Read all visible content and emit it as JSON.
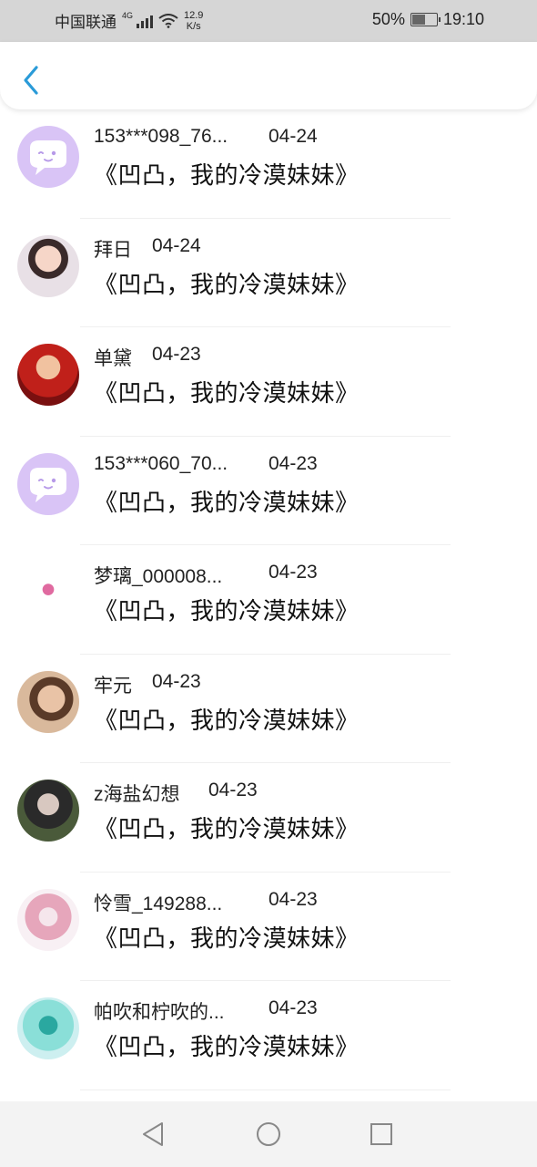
{
  "status_bar": {
    "carrier": "中国联通",
    "network": "4G",
    "speed_value": "12.9",
    "speed_unit": "K/s",
    "battery": "50%",
    "battery_level": 0.5,
    "time": "19:10"
  },
  "header": {
    "back_icon": "chevron-left-icon",
    "accent_color": "#2a9bd8"
  },
  "items": [
    {
      "name": "153***098_76...",
      "date": "04-24",
      "title": "《凹凸，我的冷漠妹妹》",
      "avatar": "default-chat-avatar"
    },
    {
      "name": "拜日",
      "date": "04-24",
      "title": "《凹凸，我的冷漠妹妹》",
      "avatar": "user-photo"
    },
    {
      "name": "单黛",
      "date": "04-23",
      "title": "《凹凸，我的冷漠妹妹》",
      "avatar": "user-photo"
    },
    {
      "name": "153***060_70...",
      "date": "04-23",
      "title": "《凹凸，我的冷漠妹妹》",
      "avatar": "default-chat-avatar"
    },
    {
      "name": "梦璃_000008...",
      "date": "04-23",
      "title": "《凹凸，我的冷漠妹妹》",
      "avatar": "user-photo"
    },
    {
      "name": "牢元",
      "date": "04-23",
      "title": "《凹凸，我的冷漠妹妹》",
      "avatar": "user-photo"
    },
    {
      "name": "z海盐幻想",
      "date": "04-23",
      "title": "《凹凸，我的冷漠妹妹》",
      "avatar": "user-photo"
    },
    {
      "name": "怜雪_149288...",
      "date": "04-23",
      "title": "《凹凸，我的冷漠妹妹》",
      "avatar": "user-photo"
    },
    {
      "name": "帕吹和柠吹的...",
      "date": "04-23",
      "title": "《凹凸，我的冷漠妹妹》",
      "avatar": "user-photo"
    }
  ],
  "nav_bar": {
    "back_icon": "triangle-back-icon",
    "home_icon": "circle-home-icon",
    "recents_icon": "square-recents-icon"
  }
}
